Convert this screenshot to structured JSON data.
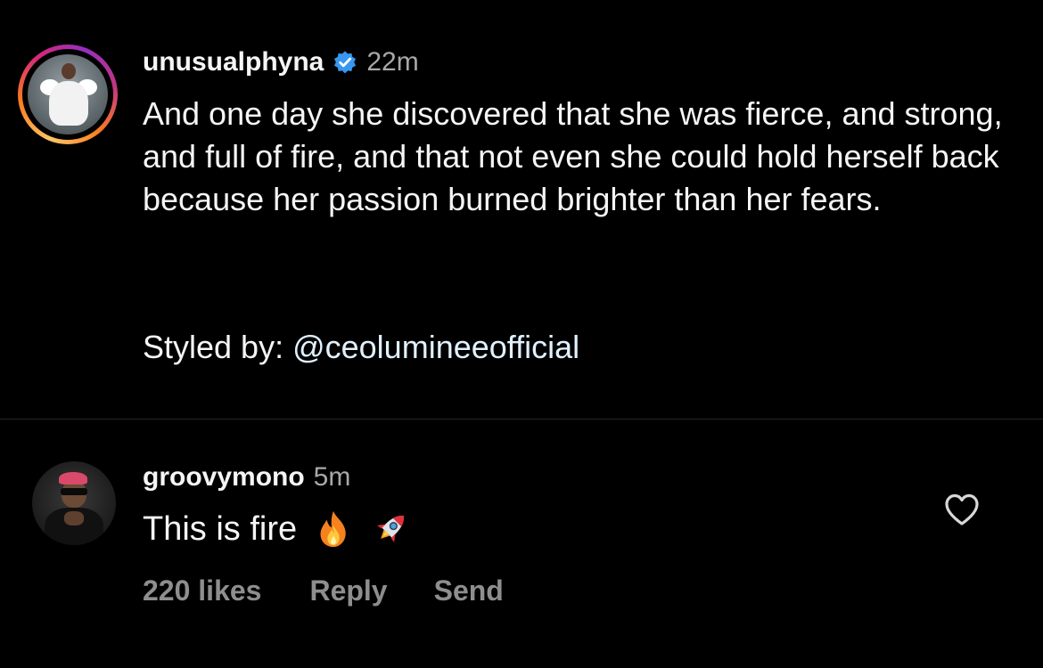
{
  "post": {
    "username": "unusualphyna",
    "verified": true,
    "timestamp": "22m",
    "caption": "And one day she discovered that she was fierce, and strong, and full of fire, and that not even she could hold herself back because her passion burned brighter than her fears.",
    "styled_by_prefix": "Styled by: ",
    "styled_by_mention": "@ceolumineeofficial"
  },
  "comment": {
    "username": "groovymono",
    "timestamp": "5m",
    "text": "This is fire",
    "emojis": [
      "fire-emoji",
      "rocket-emoji"
    ],
    "likes_label": "220 likes",
    "reply_label": "Reply",
    "send_label": "Send"
  },
  "colors": {
    "background": "#000000",
    "text_primary": "#f5f5f5",
    "text_secondary": "#a8a8a8",
    "action_text": "#8e8e8e",
    "verified_badge": "#3897f0",
    "mention": "#e0f1ff",
    "divider": "#262626"
  },
  "icons": {
    "verified": "verified-badge-icon",
    "like": "heart-icon"
  }
}
